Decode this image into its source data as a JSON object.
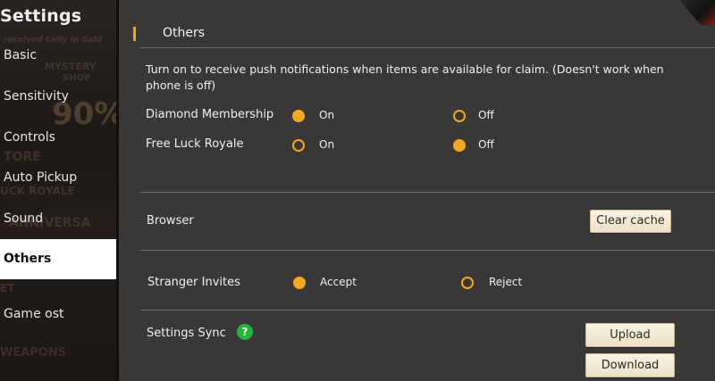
{
  "sidebar": {
    "title": "Settings",
    "items": [
      {
        "label": "Basic"
      },
      {
        "label": "Sensitivity"
      },
      {
        "label": "Controls"
      },
      {
        "label": "Auto Pickup"
      },
      {
        "label": "Sound"
      },
      {
        "label": "Others"
      },
      {
        "label": "Game ost"
      }
    ],
    "active_index": 5,
    "background_text": [
      "received Kelly in Gold",
      "MYSTERY",
      "SHOP",
      "90%",
      "TORE",
      "UCK ROYALE",
      "ANNIVERSA",
      "ET",
      "WEAPONS"
    ]
  },
  "main": {
    "section_title": "Others",
    "notice": "Turn on to receive push notifications when items are available for claim. (Doesn't work when phone is off)",
    "notification_rows": [
      {
        "label": "Diamond Membership",
        "on_label": "On",
        "off_label": "Off",
        "selected": "On"
      },
      {
        "label": "Free Luck Royale",
        "on_label": "On",
        "off_label": "Off",
        "selected": "Off"
      }
    ],
    "browser": {
      "label": "Browser",
      "button": "Clear cache"
    },
    "stranger_invites": {
      "label": "Stranger Invites",
      "accept_label": "Accept",
      "reject_label": "Reject",
      "selected": "Accept"
    },
    "settings_sync": {
      "label": "Settings Sync",
      "help_glyph": "?",
      "upload_button": "Upload",
      "download_button": "Download"
    }
  },
  "colors": {
    "accent": "#f5a623",
    "panel": "#3a3836",
    "help_icon": "#25b33b",
    "button_bg": "#faf3e4"
  }
}
